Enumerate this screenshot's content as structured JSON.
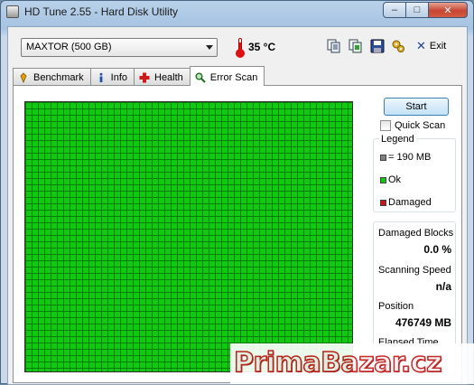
{
  "window": {
    "title": "HD Tune 2.55 - Hard Disk Utility",
    "minimize_glyph": "–",
    "maximize_glyph": "□",
    "close_glyph": "✕"
  },
  "toolbar": {
    "drive": "MAXTOR (500 GB)",
    "temperature": "35 °C",
    "exit_label": "Exit",
    "icons": [
      "copy-info-icon",
      "copy-screenshot-icon",
      "save-icon",
      "options-icon",
      "exit-icon"
    ]
  },
  "tabs": [
    {
      "label": "Benchmark",
      "icon": "benchmark-icon"
    },
    {
      "label": "Info",
      "icon": "info-icon"
    },
    {
      "label": "Health",
      "icon": "health-icon"
    },
    {
      "label": "Error Scan",
      "icon": "search-icon",
      "active": true
    }
  ],
  "scan": {
    "start_label": "Start",
    "quick_scan_label": "Quick Scan",
    "quick_scan_checked": false
  },
  "legend": {
    "title": "Legend",
    "items": [
      {
        "label": "= 190 MB",
        "color": "#808080"
      },
      {
        "label": "Ok",
        "color": "#11c911"
      },
      {
        "label": "Damaged",
        "color": "#c81414"
      }
    ]
  },
  "stats": {
    "damaged_blocks_label": "Damaged Blocks",
    "damaged_blocks_value": "0.0 %",
    "scanning_speed_label": "Scanning Speed",
    "scanning_speed_value": "n/a",
    "position_label": "Position",
    "position_value": "476749 MB",
    "elapsed_label": "Elapsed Time"
  },
  "colors": {
    "ok_block": "#11c911",
    "damaged_block": "#c81414",
    "watermark_red": "#c21a1a"
  },
  "watermark": {
    "text": "PrimaBazar.cz"
  }
}
